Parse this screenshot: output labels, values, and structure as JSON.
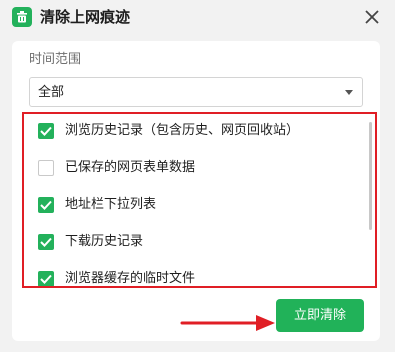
{
  "window": {
    "title": "清除上网痕迹",
    "icon": "trash-bin-icon",
    "close_icon": "close-icon"
  },
  "time_range": {
    "label": "时间范围",
    "selected": "全部"
  },
  "items": [
    {
      "label": "浏览历史记录（包含历史、网页回收站）",
      "checked": true
    },
    {
      "label": "已保存的网页表单数据",
      "checked": false
    },
    {
      "label": "地址栏下拉列表",
      "checked": true
    },
    {
      "label": "下载历史记录",
      "checked": true
    },
    {
      "label": "浏览器缓存的临时文件",
      "checked": true
    }
  ],
  "actions": {
    "clear_label": "立即清除"
  },
  "colors": {
    "accent_green": "#21b259",
    "highlight_red": "#e01e25"
  }
}
